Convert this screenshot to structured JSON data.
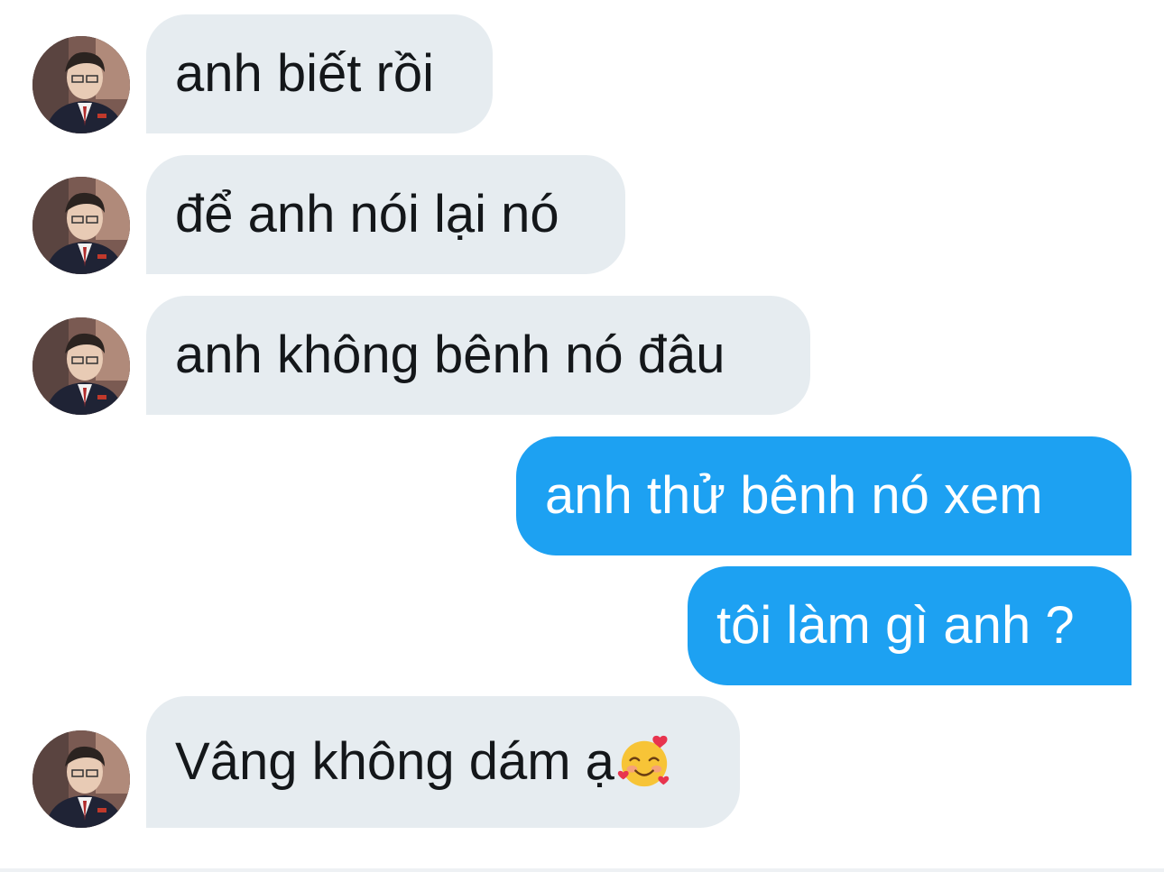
{
  "conversation": {
    "messages": [
      {
        "sender": "other",
        "text": "anh biết rồi"
      },
      {
        "sender": "other",
        "text": "để anh nói lại nó"
      },
      {
        "sender": "other",
        "text": "anh không bênh nó đâu"
      },
      {
        "sender": "me",
        "text": "anh thử bênh nó xem"
      },
      {
        "sender": "me",
        "text": "tôi làm gì anh ?"
      },
      {
        "sender": "other",
        "text": "Vâng không dám ạ",
        "emoji": "smiling-face-with-hearts-icon"
      }
    ]
  },
  "colors": {
    "incoming_bubble": "#e6ecf0",
    "outgoing_bubble": "#1da1f2",
    "incoming_text": "#14171a",
    "outgoing_text": "#ffffff"
  },
  "icons": {
    "avatar": "profile-photo-avatar",
    "emoji": "smiling-face-with-hearts-icon"
  }
}
